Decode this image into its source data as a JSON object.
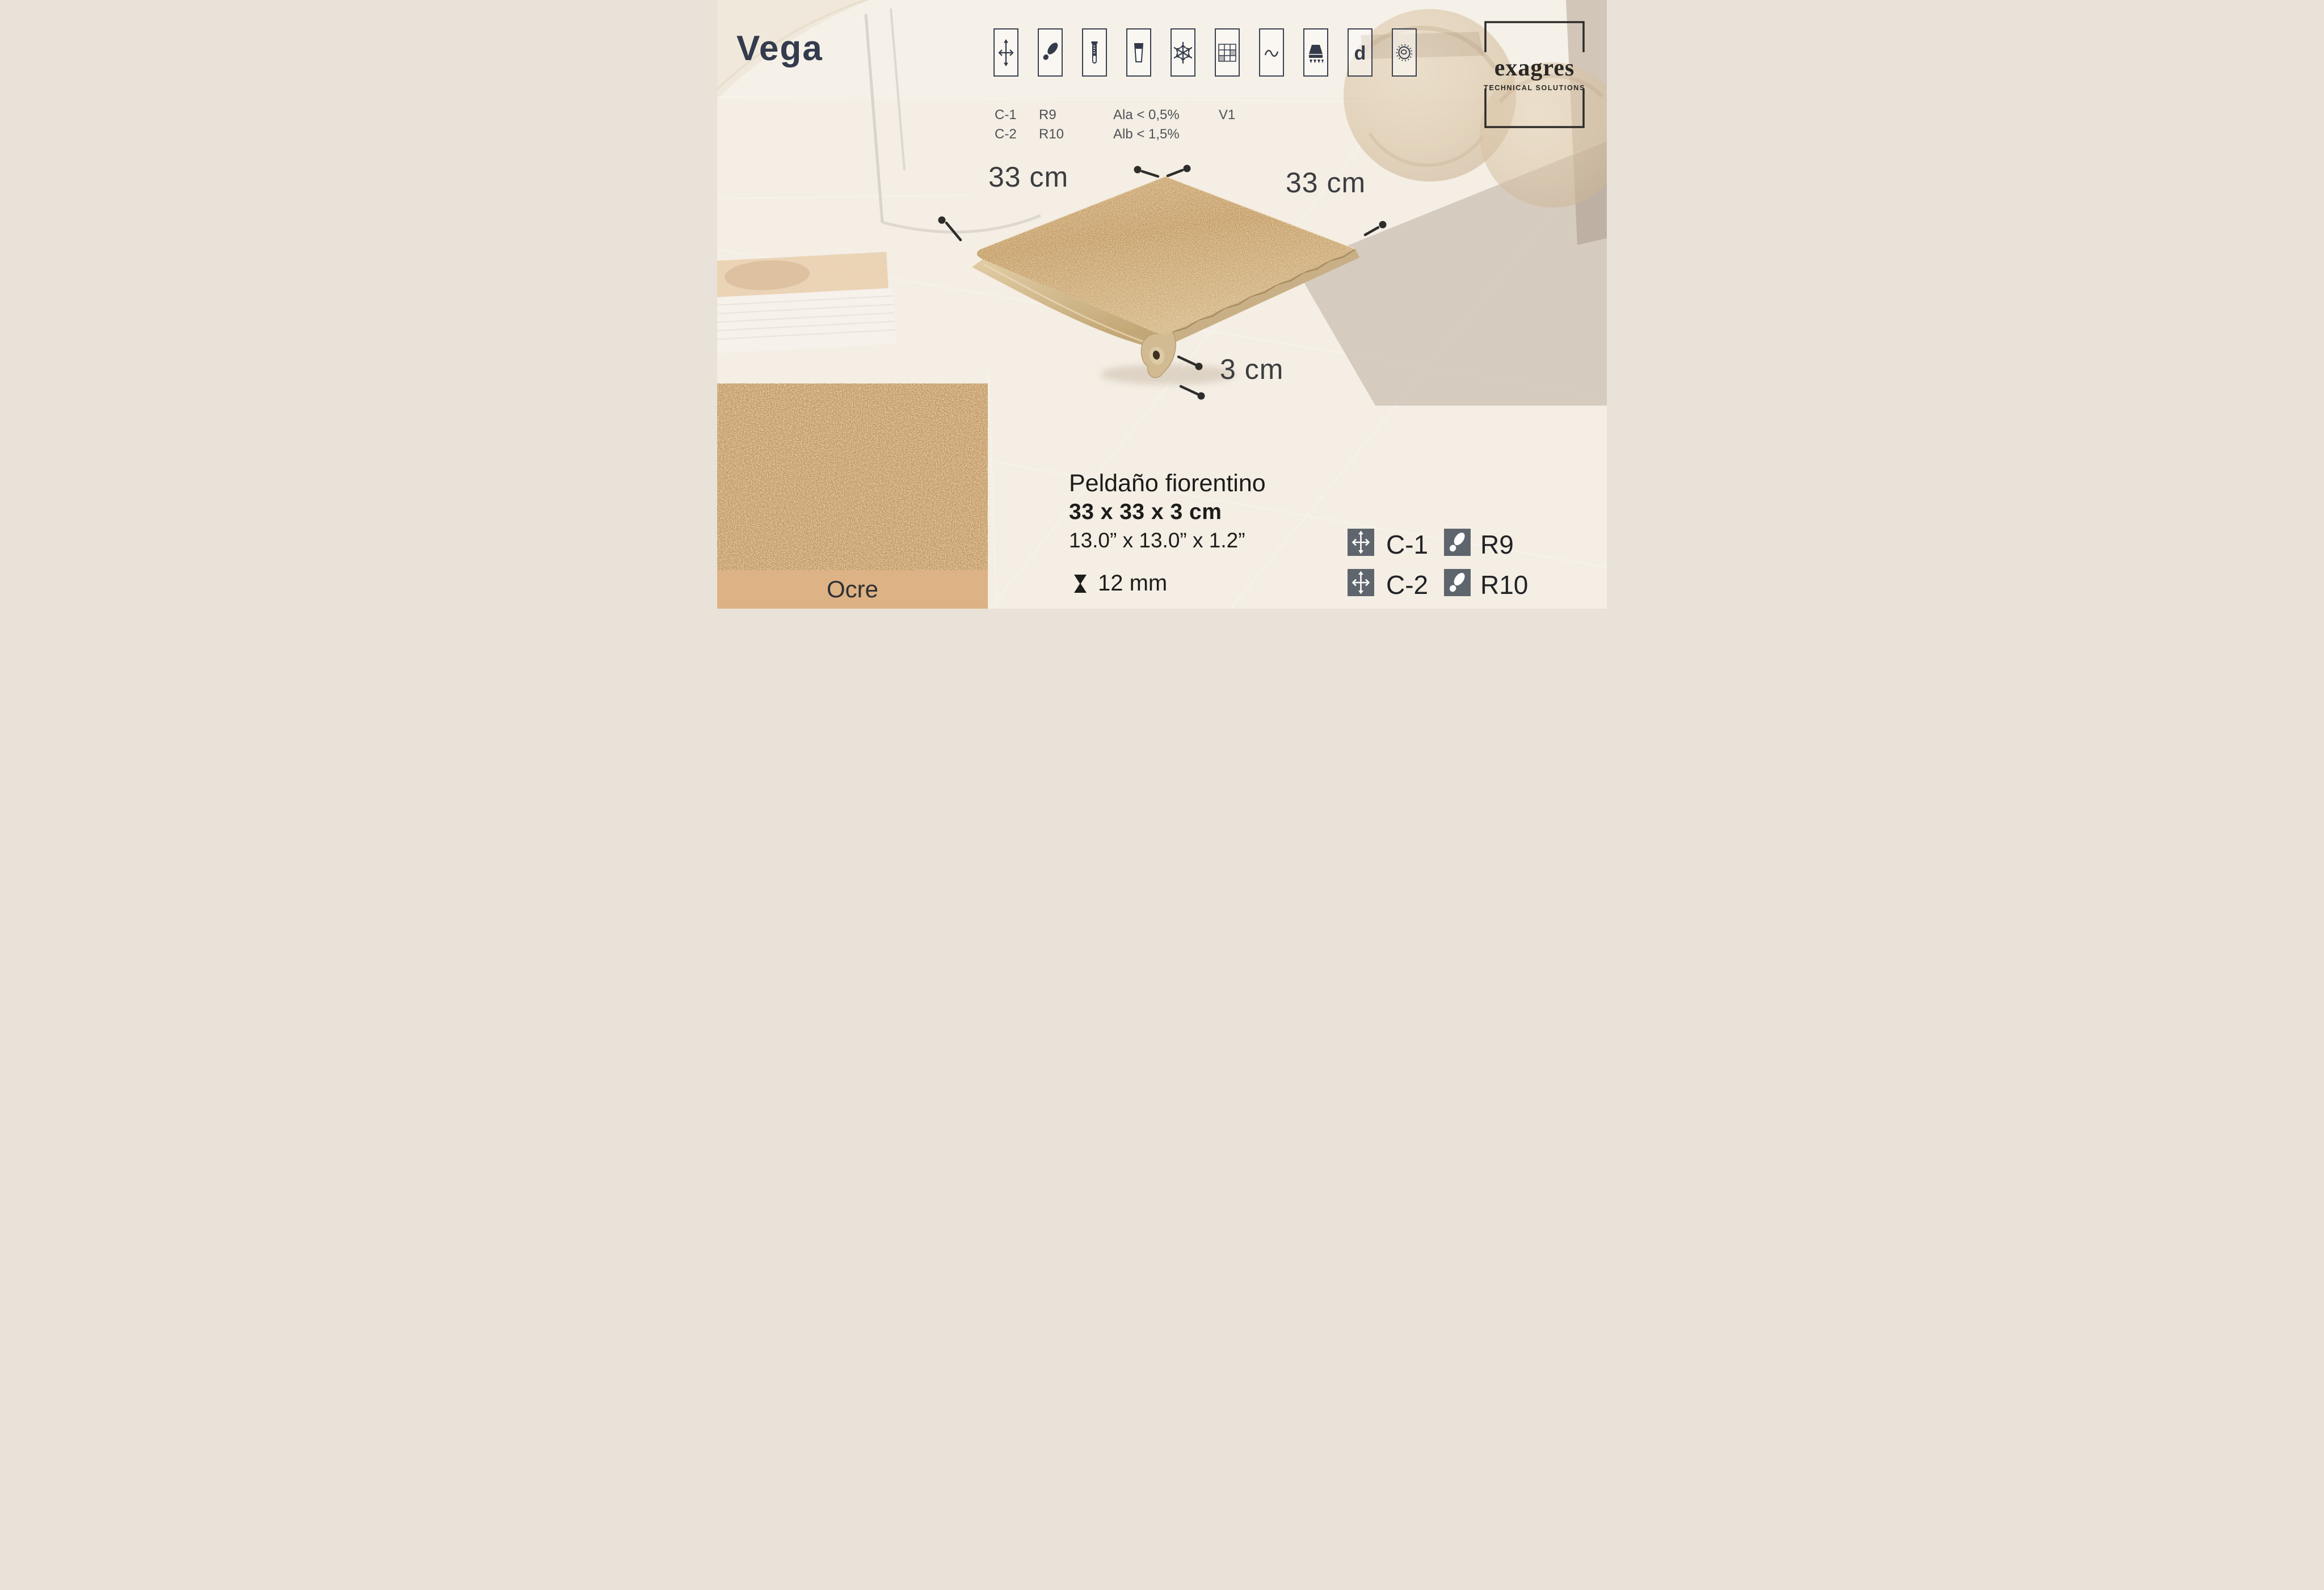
{
  "page": {
    "title": "Vega"
  },
  "logo": {
    "brand": "exagres",
    "tagline": "TECHNICAL SOLUTIONS"
  },
  "top_icons": {
    "items": [
      "expansion-joint-icon",
      "slip-resistance-icon",
      "water-absorption-icon",
      "chemical-resistance-icon",
      "frost-resistance-icon",
      "shade-variation-icon",
      "flexural-strength-icon",
      "extruded-tile-icon",
      "density-icon",
      "antibacterial-icon"
    ],
    "density_letter": "d",
    "labels": {
      "col1_line1": "C-1",
      "col1_line2": "C-2",
      "col2_line1": "R9",
      "col2_line2": "R10",
      "col3_line1": "Ala < 0,5%",
      "col3_line2": "Alb < 1,5%",
      "col4_line1": "V1"
    }
  },
  "diagram": {
    "width_label": "33 cm",
    "depth_label": "33 cm",
    "thickness_label": "3 cm"
  },
  "product": {
    "name": "Peldaño fiorentino",
    "size_cm": "33 x 33 x 3 cm",
    "size_inches": "13.0” x 13.0” x 1.2”",
    "thickness": "12 mm"
  },
  "specs": {
    "row1": [
      {
        "value": "C-1"
      },
      {
        "value": "R9"
      }
    ],
    "row2": [
      {
        "value": "C-2"
      },
      {
        "value": "R10"
      }
    ]
  },
  "swatch": {
    "label": "Ocre",
    "bar_color": "#ddb285",
    "base_color": "#c1945c"
  },
  "colors": {
    "title": "#333b4d",
    "icon_ink": "#333b4a",
    "badge_gray": "#5f656d",
    "text_dark": "#1c1c1a",
    "dim_gray": "#3c3d40"
  }
}
